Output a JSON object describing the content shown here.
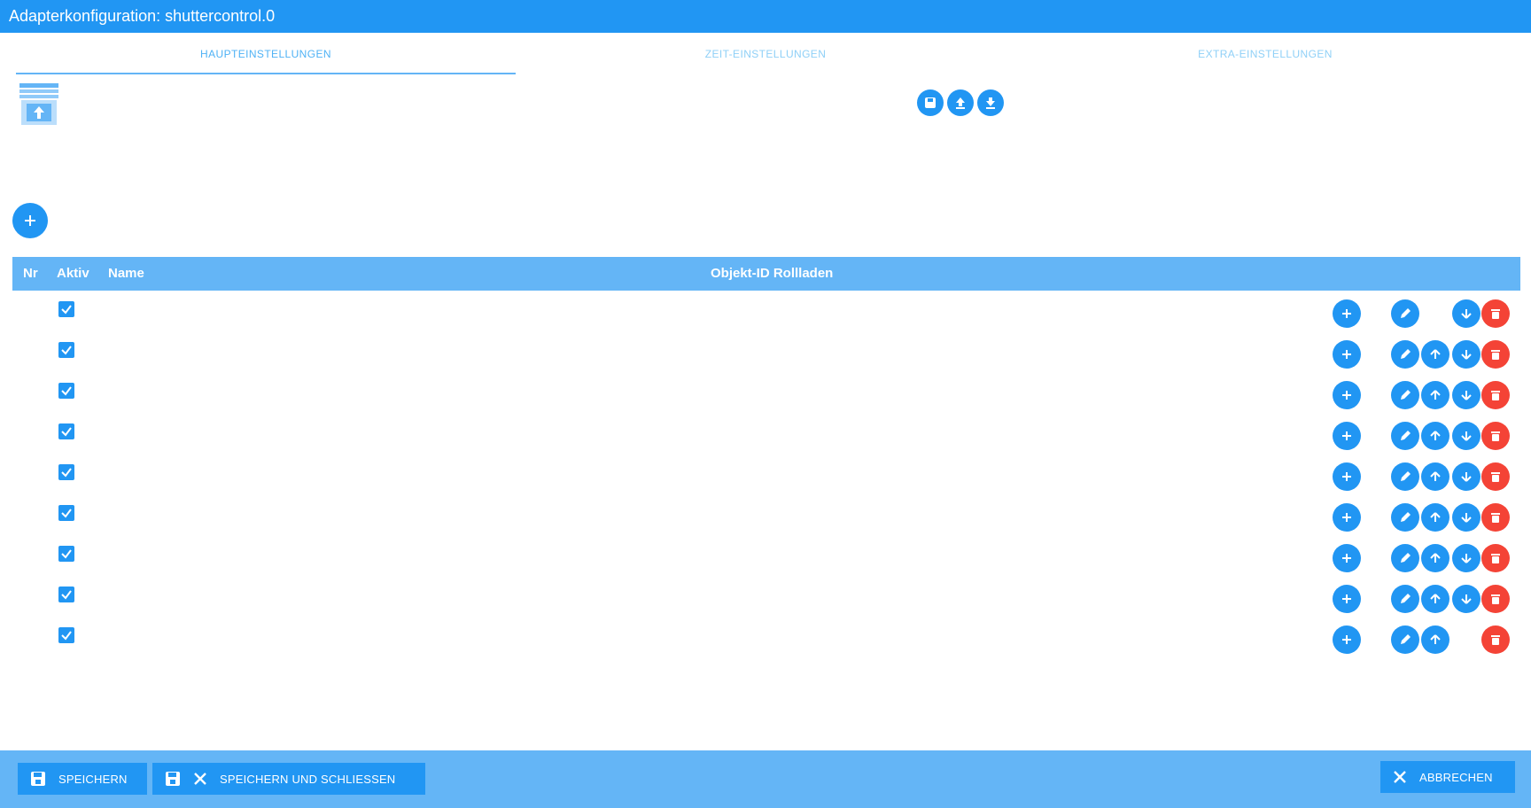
{
  "window": {
    "title": "Adapterkonfiguration: shuttercontrol.0"
  },
  "tabs": [
    {
      "label": "HAUPTEINSTELLUNGEN",
      "active": true
    },
    {
      "label": "ZEIT-EINSTELLUNGEN",
      "active": false
    },
    {
      "label": "EXTRA-EINSTELLUNGEN",
      "active": false
    }
  ],
  "table": {
    "headers": {
      "nr": "Nr",
      "aktiv": "Aktiv",
      "name": "Name",
      "object_id": "Objekt-ID Rollladen"
    },
    "rows": [
      {
        "aktiv": true,
        "up": false,
        "down": true
      },
      {
        "aktiv": true,
        "up": true,
        "down": true
      },
      {
        "aktiv": true,
        "up": true,
        "down": true
      },
      {
        "aktiv": true,
        "up": true,
        "down": true
      },
      {
        "aktiv": true,
        "up": true,
        "down": true
      },
      {
        "aktiv": true,
        "up": true,
        "down": true
      },
      {
        "aktiv": true,
        "up": true,
        "down": true
      },
      {
        "aktiv": true,
        "up": true,
        "down": true
      },
      {
        "aktiv": true,
        "up": true,
        "down": false
      }
    ]
  },
  "footer": {
    "save_label": "SPEICHERN",
    "save_close_label": "SPEICHERN UND SCHLIESSEN",
    "cancel_label": "ABBRECHEN"
  },
  "colors": {
    "primary": "#2196f3",
    "header": "#64b5f6",
    "delete": "#f44336"
  }
}
